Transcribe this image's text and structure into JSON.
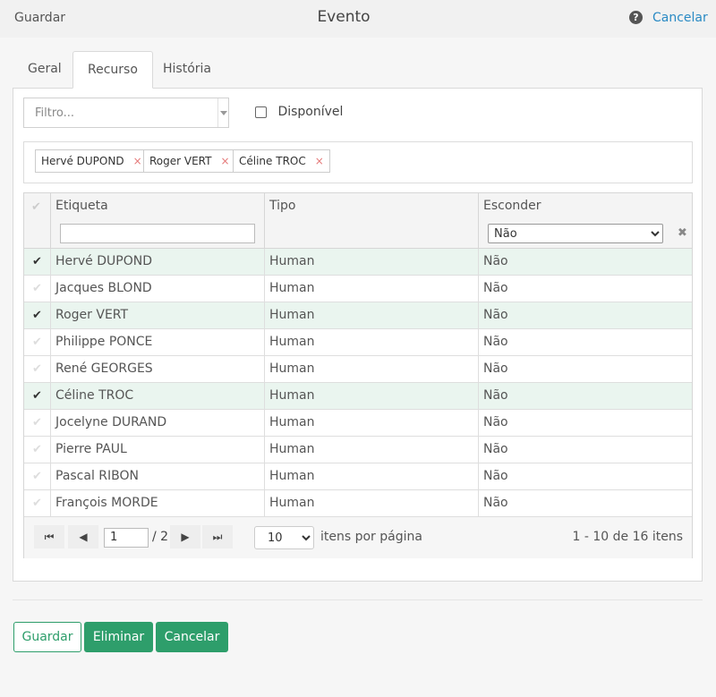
{
  "header": {
    "save_label": "Guardar",
    "title": "Evento",
    "help_glyph": "?",
    "cancel_label": "Cancelar"
  },
  "tabs": [
    {
      "label": "Geral",
      "active": false
    },
    {
      "label": "Recurso",
      "active": true
    },
    {
      "label": "História",
      "active": false
    }
  ],
  "filter": {
    "placeholder": "Filtro...",
    "available_label": "Disponível",
    "available_checked": false
  },
  "selected_chips": [
    {
      "label": "Hervé DUPOND",
      "remove": "×"
    },
    {
      "label": "Roger VERT",
      "remove": "×"
    },
    {
      "label": "Céline TROC",
      "remove": "×"
    }
  ],
  "grid": {
    "columns": [
      "Etiqueta",
      "Tipo",
      "Esconder"
    ],
    "hide_filter_value": "Não",
    "clear_glyph": "✖",
    "check_glyph": "✔",
    "rows": [
      {
        "selected": true,
        "label": "Hervé DUPOND",
        "type": "Human",
        "hide": "Não"
      },
      {
        "selected": false,
        "label": "Jacques BLOND",
        "type": "Human",
        "hide": "Não"
      },
      {
        "selected": true,
        "label": "Roger VERT",
        "type": "Human",
        "hide": "Não"
      },
      {
        "selected": false,
        "label": "Philippe PONCE",
        "type": "Human",
        "hide": "Não"
      },
      {
        "selected": false,
        "label": "René GEORGES",
        "type": "Human",
        "hide": "Não"
      },
      {
        "selected": true,
        "label": "Céline TROC",
        "type": "Human",
        "hide": "Não"
      },
      {
        "selected": false,
        "label": "Jocelyne DURAND",
        "type": "Human",
        "hide": "Não"
      },
      {
        "selected": false,
        "label": "Pierre PAUL",
        "type": "Human",
        "hide": "Não"
      },
      {
        "selected": false,
        "label": "Pascal RIBON",
        "type": "Human",
        "hide": "Não"
      },
      {
        "selected": false,
        "label": "François MORDE",
        "type": "Human",
        "hide": "Não"
      }
    ]
  },
  "pager": {
    "first_glyph": "⏮",
    "prev_glyph": "◀",
    "next_glyph": "▶",
    "last_glyph": "⏭",
    "current_page": "1",
    "total_pages": "/ 2",
    "page_size": "10",
    "per_page_label": "itens por página",
    "range_label": "1 - 10 de 16 itens"
  },
  "footer": {
    "save_label": "Guardar",
    "delete_label": "Eliminar",
    "cancel_label": "Cancelar"
  },
  "colors": {
    "accent": "#2e9e6b",
    "link": "#2a8ac4",
    "selected_row": "#eaf5ef"
  }
}
